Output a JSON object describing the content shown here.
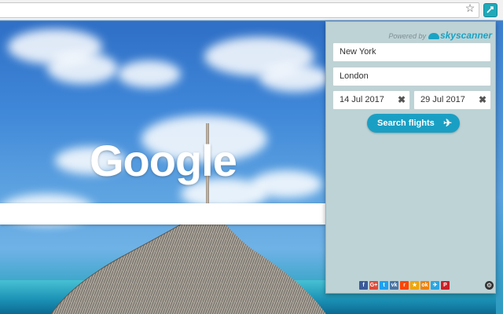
{
  "browser": {
    "icons": {
      "bookmark": "star-icon",
      "extension": "skyscanner-extension-icon"
    }
  },
  "newtab": {
    "logo_text": "Google"
  },
  "popup": {
    "powered_by": "Powered by",
    "brand": "skyscanner",
    "from_value": "New York",
    "to_value": "London",
    "depart_date": "14 Jul 2017",
    "return_date": "29 Jul 2017",
    "clear_symbol": "✖",
    "search_label": "Search flights",
    "plane_symbol": "✈",
    "share_services": [
      {
        "label": "f",
        "color": "#3b5998",
        "name": "facebook-icon"
      },
      {
        "label": "G+",
        "color": "#dd4b39",
        "name": "google-plus-icon"
      },
      {
        "label": "t",
        "color": "#1da1f2",
        "name": "twitter-icon"
      },
      {
        "label": "vk",
        "color": "#4c75a3",
        "name": "vk-icon"
      },
      {
        "label": "r",
        "color": "#ff4500",
        "name": "reddit-icon"
      },
      {
        "label": "★",
        "color": "#f0a500",
        "name": "favorites-icon"
      },
      {
        "label": "ok",
        "color": "#ee8208",
        "name": "odnoklassniki-icon"
      },
      {
        "label": "✈",
        "color": "#2ca5e0",
        "name": "telegram-icon"
      },
      {
        "label": "P",
        "color": "#cb2027",
        "name": "pinterest-icon"
      }
    ],
    "settings_icon": "gear-icon"
  }
}
